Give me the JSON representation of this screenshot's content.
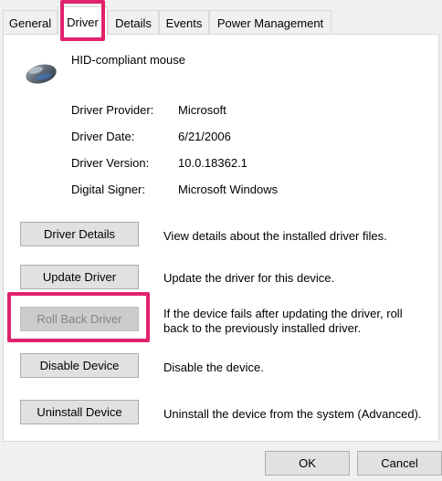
{
  "tabs": [
    {
      "label": "General"
    },
    {
      "label": "Driver"
    },
    {
      "label": "Details"
    },
    {
      "label": "Events"
    },
    {
      "label": "Power Management"
    }
  ],
  "device": {
    "icon": "mouse-icon",
    "name": "HID-compliant mouse"
  },
  "properties": [
    {
      "label": "Driver Provider:",
      "value": "Microsoft"
    },
    {
      "label": "Driver Date:",
      "value": "6/21/2006"
    },
    {
      "label": "Driver Version:",
      "value": "10.0.18362.1"
    },
    {
      "label": "Digital Signer:",
      "value": "Microsoft Windows"
    }
  ],
  "actions": [
    {
      "label": "Driver Details",
      "description": "View details about the installed driver files.",
      "enabled": true
    },
    {
      "label": "Update Driver",
      "description": "Update the driver for this device.",
      "enabled": true
    },
    {
      "label": "Roll Back Driver",
      "description_line1": "If the device fails after updating the driver, roll",
      "description_line2": "back to the previously installed driver.",
      "enabled": false
    },
    {
      "label": "Disable Device",
      "description": "Disable the device.",
      "enabled": true
    },
    {
      "label": "Uninstall Device",
      "description": "Uninstall the device from the system (Advanced).",
      "enabled": true
    }
  ],
  "footer": {
    "ok_label": "OK",
    "cancel_label": "Cancel"
  },
  "colors": {
    "highlight": "#e0226d",
    "panel": "#ffffff",
    "window": "#f0f0f0"
  }
}
